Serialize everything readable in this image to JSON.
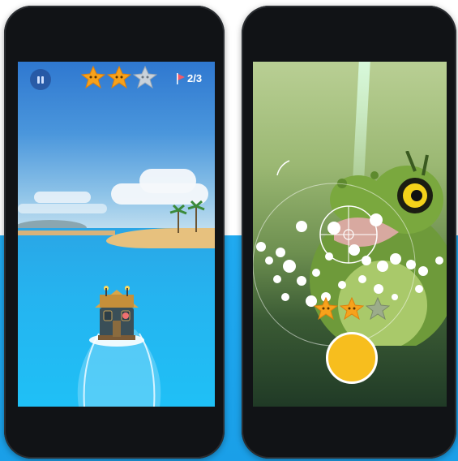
{
  "left_screen": {
    "hud": {
      "pause_icon": "pause-icon",
      "stars_earned": 2,
      "stars_total": 3,
      "level_progress": "2/3",
      "flag_icon": "flag-icon",
      "flag_color": "#f25a6a",
      "star_color_filled": "#f7a21b",
      "star_color_empty": "#c9d2db"
    }
  },
  "right_screen": {
    "stars_earned": 2,
    "stars_total": 3,
    "capture_button_color": "#f7be1e"
  },
  "background_band_color": "#20aaf0"
}
